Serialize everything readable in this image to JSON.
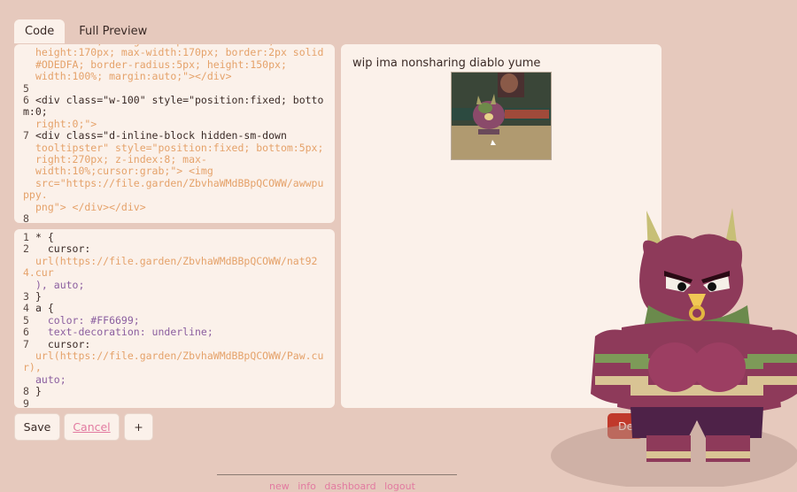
{
  "tabs": {
    "code": "Code",
    "preview": "Full Preview"
  },
  "html_editor": {
    "lines": [
      {
        "n": "",
        "text": "size:cover; background-position:center;"
      },
      {
        "n": "",
        "text": "height:170px; max-width:170px; border:2px solid"
      },
      {
        "n": "",
        "text": "#ODEDFA; border-radius:5px; height:150px;"
      },
      {
        "n": "",
        "text": "width:100%; margin:auto;\"></div>"
      },
      {
        "n": "5",
        "text": ""
      },
      {
        "n": "6",
        "text": "<div class=\"w-100\" style=\"position:fixed; bottom:0;"
      },
      {
        "n": "",
        "text": "right:0;\">"
      },
      {
        "n": "7",
        "text": "<div class=\"d-inline-block hidden-sm-down"
      },
      {
        "n": "",
        "text": "tooltipster\" style=\"position:fixed; bottom:5px;"
      },
      {
        "n": "",
        "text": "right:270px; z-index:8; max-"
      },
      {
        "n": "",
        "text": "width:10%;cursor:grab;\"> <img"
      },
      {
        "n": "",
        "text": "src=\"https://file.garden/ZbvhaWMdBBpQCOWW/awwpuppy."
      },
      {
        "n": "",
        "text": "png\"> </div></div>"
      },
      {
        "n": "8",
        "text": ""
      }
    ]
  },
  "css_editor": {
    "lines": [
      {
        "n": "1",
        "text": "* {"
      },
      {
        "n": "2",
        "text": "  cursor:"
      },
      {
        "n": "",
        "text": "url(https://file.garden/ZbvhaWMdBBpQCOWW/nat924.cur"
      },
      {
        "n": "",
        "text": "), auto;"
      },
      {
        "n": "3",
        "text": "}"
      },
      {
        "n": "4",
        "text": "a {"
      },
      {
        "n": "5",
        "text": "  color: #FF6699;"
      },
      {
        "n": "6",
        "text": "  text-decoration: underline;"
      },
      {
        "n": "7",
        "text": "  cursor:"
      },
      {
        "n": "",
        "text": "url(https://file.garden/ZbvhaWMdBBpQCOWW/Paw.cur),"
      },
      {
        "n": "",
        "text": "auto;"
      },
      {
        "n": "8",
        "text": "}"
      },
      {
        "n": "9",
        "text": ""
      }
    ]
  },
  "preview": {
    "title": "wip ima nonsharing diablo yume"
  },
  "buttons": {
    "save": "Save",
    "cancel": "Cancel",
    "add": "+",
    "delete": "De"
  },
  "footer": {
    "links": [
      "new",
      "info",
      "dashboard",
      "logout"
    ]
  },
  "colors": {
    "background": "#e6c9bd",
    "panel": "#fbf1ea",
    "link": "#e27aa0",
    "danger": "#c0392b"
  }
}
